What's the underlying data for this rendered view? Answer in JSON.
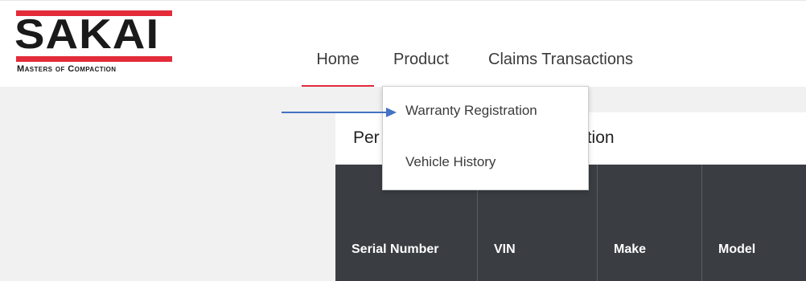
{
  "brand": {
    "name": "SAKAI",
    "tagline": "Masters of Compaction",
    "accent_color": "#e32b3a"
  },
  "nav": {
    "items": [
      {
        "label": "Home",
        "active": true
      },
      {
        "label": "Product",
        "active": false
      },
      {
        "label": "Claims Transactions",
        "active": false
      }
    ]
  },
  "product_menu": {
    "items": [
      {
        "label": "Warranty Registration"
      },
      {
        "label": "Vehicle History"
      }
    ]
  },
  "card": {
    "title_left": "Per",
    "title_right": "tion"
  },
  "table": {
    "columns": [
      "Serial Number",
      "VIN",
      "Make",
      "Model"
    ]
  },
  "annotation": {
    "arrow_color": "#4472c4",
    "points_to": "Warranty Registration"
  }
}
